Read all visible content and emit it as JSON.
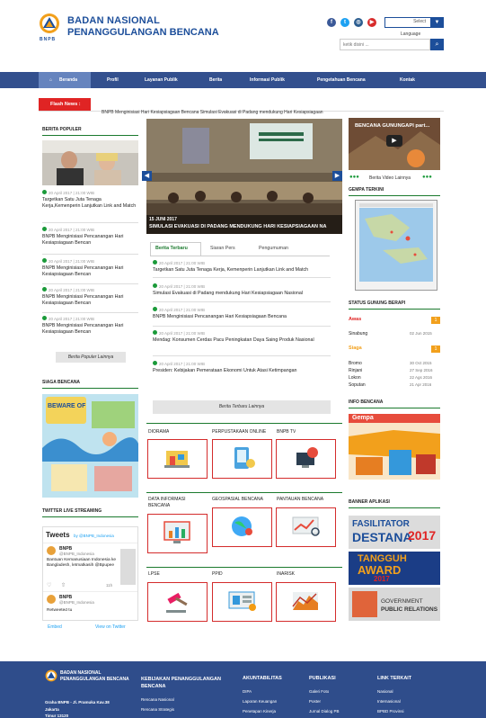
{
  "header": {
    "logo_text": "BNPB",
    "org_line1": "BADAN NASIONAL",
    "org_line2": "PENANGGULANGAN BENCANA",
    "social_icons": [
      "facebook-icon",
      "twitter-icon",
      "instagram-icon",
      "youtube-icon"
    ],
    "select_label": "Select",
    "language_label": "Language",
    "search_placeholder": "ketik disini ..."
  },
  "nav": {
    "items": [
      "Beranda",
      "Profil",
      "Layanan Publik",
      "Berita",
      "Informasi Publik",
      "Pengetahuan Bencana",
      "Kontak"
    ]
  },
  "flash": {
    "label": "Flash News :",
    "text": "BNPB Menginisiasi Hari Kesiapsiagaan Bencana   Simulasi Evakuasi di Padang mendukung Hari Kesiapsiagaan"
  },
  "popular": {
    "title": "BERITA POPULER",
    "items": [
      {
        "date": "20 April 2017 | 21:00 WIB",
        "title": "Targetkan Satu Juta Tenaga Kerja,Kemenperin Lanjutkan Link and Match"
      },
      {
        "date": "20 April 2017 | 21:00 WIB",
        "title": "BNPB Menginisiasi Pencanangan Hari Kesiapsiagaan Bencan"
      },
      {
        "date": "20 April 2017 | 21:00 WIB",
        "title": "BNPB Menginisiasi Pencanangan Hari Kesiapsiagaan Bencan"
      },
      {
        "date": "20 April 2017 | 21:00 WIB",
        "title": "BNPB Menginisiasi Pencanangan Hari Kesiapsiagaan Bencan"
      },
      {
        "date": "20 April 2017 | 21:00 WIB",
        "title": "BNPB Menginisiasi Pencanangan Hari Kesiapsiagaan Bencan"
      }
    ],
    "more": "Berita Populer Lainnya"
  },
  "siaga": {
    "title": "SIAGA BENCANA",
    "poster": "BEWARE OF TSUNAMI"
  },
  "twitter": {
    "title": "TWITTER LIVE STREAMING",
    "header": "Tweets",
    "by": "by @BNPB_Indonesia",
    "tweets": [
      {
        "name": "BNPB",
        "handle": "@BNPB_Indonesia",
        "text": "Bantuan Kemanusiaan Indonesia ke Bangladesh, letmatkasih @Bpupee",
        "time": "11h"
      },
      {
        "name": "BNPB",
        "handle": "@BNPB_Indonesia",
        "text": "Retweeted tu"
      }
    ],
    "embed": "Embed",
    "view": "View on Twitter"
  },
  "slider": {
    "date": "15 JUNI 2017",
    "caption": "SIMULASI EVAKUASI DI PADANG MENDUKUNG HARI KESIAPSIAGAAN NA"
  },
  "tabs": [
    "Berita Terbaru",
    "Siaran Pers",
    "Pengumuman"
  ],
  "news": [
    {
      "date": "20 April 2017 | 21:00 WIB",
      "title": "Targetkan Satu Juta Tenaga Kerja, Kemenperin Lanjutkan Link and Match"
    },
    {
      "date": "20 April 2017 | 21:00 WIB",
      "title": "Simulasi Evakuasi di Padang mendukung Hari Kesiapsiagaan Nasional"
    },
    {
      "date": "20 April 2017 | 21:00 WIB",
      "title": "BNPB Menginisiasi Pencanangan Hari Kesiapsiagaan Bencana"
    },
    {
      "date": "20 April 2017 | 21:00 WIB",
      "title": "Mendag: Konsumen Cerdas Pacu Peningkatan Daya Saing Produk Nasional"
    },
    {
      "date": "20 April 2017 | 21:00 WIB",
      "title": "Presiden: Kebijakan Pemerataan Ekonomi Untuk Atasi Ketimpangan"
    }
  ],
  "news_more": "Berita Terbaru Lainnya",
  "boxes": [
    "DIORAMA",
    "PERPUSTAKAAN ONLINE",
    "BNPB TV",
    "DATA INFORMASI BENCANA",
    "GEOSPASIAL BENCANA",
    "PANTAUAN BENCANA",
    "LPSE",
    "PPID",
    "INARISK"
  ],
  "video": {
    "title": "BENCANA GUNUNGAPI part...",
    "more": "Berita Video Lainnya"
  },
  "gempa": {
    "title": "GEMPA TERKINI"
  },
  "gunung": {
    "title": "STATUS GUNUNG BERAPI",
    "awas_label": "Awas",
    "awas_count": "1",
    "awas_items": [
      {
        "name": "Sinabung",
        "date": "02 Jun 2015"
      }
    ],
    "siaga_label": "Siaga",
    "siaga_count": "1",
    "siaga_items": [
      {
        "name": "Bromo",
        "date": "30 Oct 2015"
      },
      {
        "name": "Rinjani",
        "date": "27 Sep 2016"
      },
      {
        "name": "Lokon",
        "date": "22 Ags 2016"
      },
      {
        "name": "Soputan",
        "date": "21 Apr 2016"
      }
    ]
  },
  "info": {
    "title": "INFO BENCANA",
    "img_text": "Gempa"
  },
  "banner": {
    "title": "BANNER APLIKASI",
    "b1_line1": "FASILITATOR",
    "b1_line2": "DESTANA",
    "b1_year": "2017",
    "b2_line1": "TANGGUH",
    "b2_line2": "AWARD",
    "b2_year": "2017",
    "b3_line1": "GOVERNMENT",
    "b3_line2": "PUBLIC RELATIONS"
  },
  "footer": {
    "org1": "BADAN NASIONAL",
    "org2": "PENANGGULANGAN BENCANA",
    "addr1": "Graha BNPB - Jl. Pramuka Kav.38",
    "addr2": "Jakarta",
    "addr3": "Timur 13120",
    "cols": [
      {
        "title": "KEBIJAKAN PENANGGULANGAN BENCANA",
        "items": [
          "Rencana Nasional",
          "Rencana Strategis"
        ]
      },
      {
        "title": "AKUNTABILITAS",
        "items": [
          "DIPA",
          "Laporan Keuangan",
          "Penetapan Kinerja"
        ]
      },
      {
        "title": "PUBLIKASI",
        "items": [
          "Galeri Foto",
          "Poster",
          "Jurnal Dialog PB"
        ]
      },
      {
        "title": "LINK TERKAIT",
        "items": [
          "Nasional",
          "Internasional",
          "BPBD Provinsi"
        ]
      }
    ]
  },
  "colors": {
    "primary": "#1c4e9a",
    "nav": "#33508e",
    "accent_red": "#e02424",
    "green": "#1b7a2e",
    "orange": "#f2a01c",
    "footer": "#2f4d8b"
  }
}
